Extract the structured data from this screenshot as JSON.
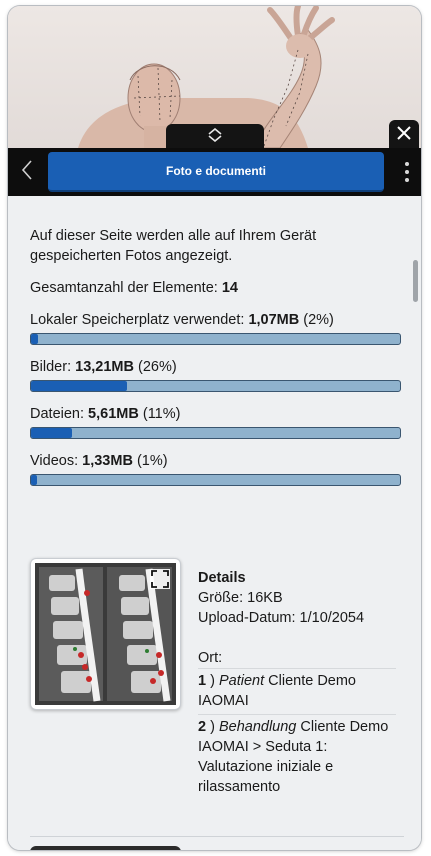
{
  "header": {
    "title": "Foto e documenti"
  },
  "icons": {
    "back": "chevron-left-icon",
    "collapse": "chevron-up-down-icon",
    "close": "close-icon",
    "menu": "more-vertical-icon",
    "expand": "expand-icon"
  },
  "colors": {
    "accent": "#1a5fb4",
    "bar_track": "#8fb2cd",
    "header_bg": "#0d0d0d",
    "content_bg": "#eef0f2"
  },
  "content": {
    "intro": "Auf dieser Seite werden alle auf Ihrem Gerät gespeicherten Fotos angezeigt.",
    "total_label": "Gesamtanzahl der Elemente:",
    "total_value": "14",
    "stats": [
      {
        "label": "Lokaler Speicherplatz verwendet:",
        "value": "1,07MB",
        "percent_text": "(2%)",
        "percent": 2
      },
      {
        "label": "Bilder:",
        "value": "13,21MB",
        "percent_text": "(26%)",
        "percent": 26
      },
      {
        "label": "Dateien:",
        "value": "5,61MB",
        "percent_text": "(11%)",
        "percent": 11
      },
      {
        "label": "Videos:",
        "value": "1,33MB",
        "percent_text": "(1%)",
        "percent": 1
      }
    ]
  },
  "item": {
    "details_heading": "Details",
    "size": "Größe: 16KB",
    "upload_date": "Upload-Datum: 1/10/2054",
    "location_label": "Ort:",
    "locations": [
      {
        "num": "1",
        "sep": " ) ",
        "type": "Patient",
        "text": " Cliente Demo IAOMAI"
      },
      {
        "num": "2",
        "sep": " ) ",
        "type": "Behandlung",
        "text": " Cliente Demo IAOMAI > Seduta 1: Valutazione iniziale e rilassamento"
      }
    ]
  }
}
